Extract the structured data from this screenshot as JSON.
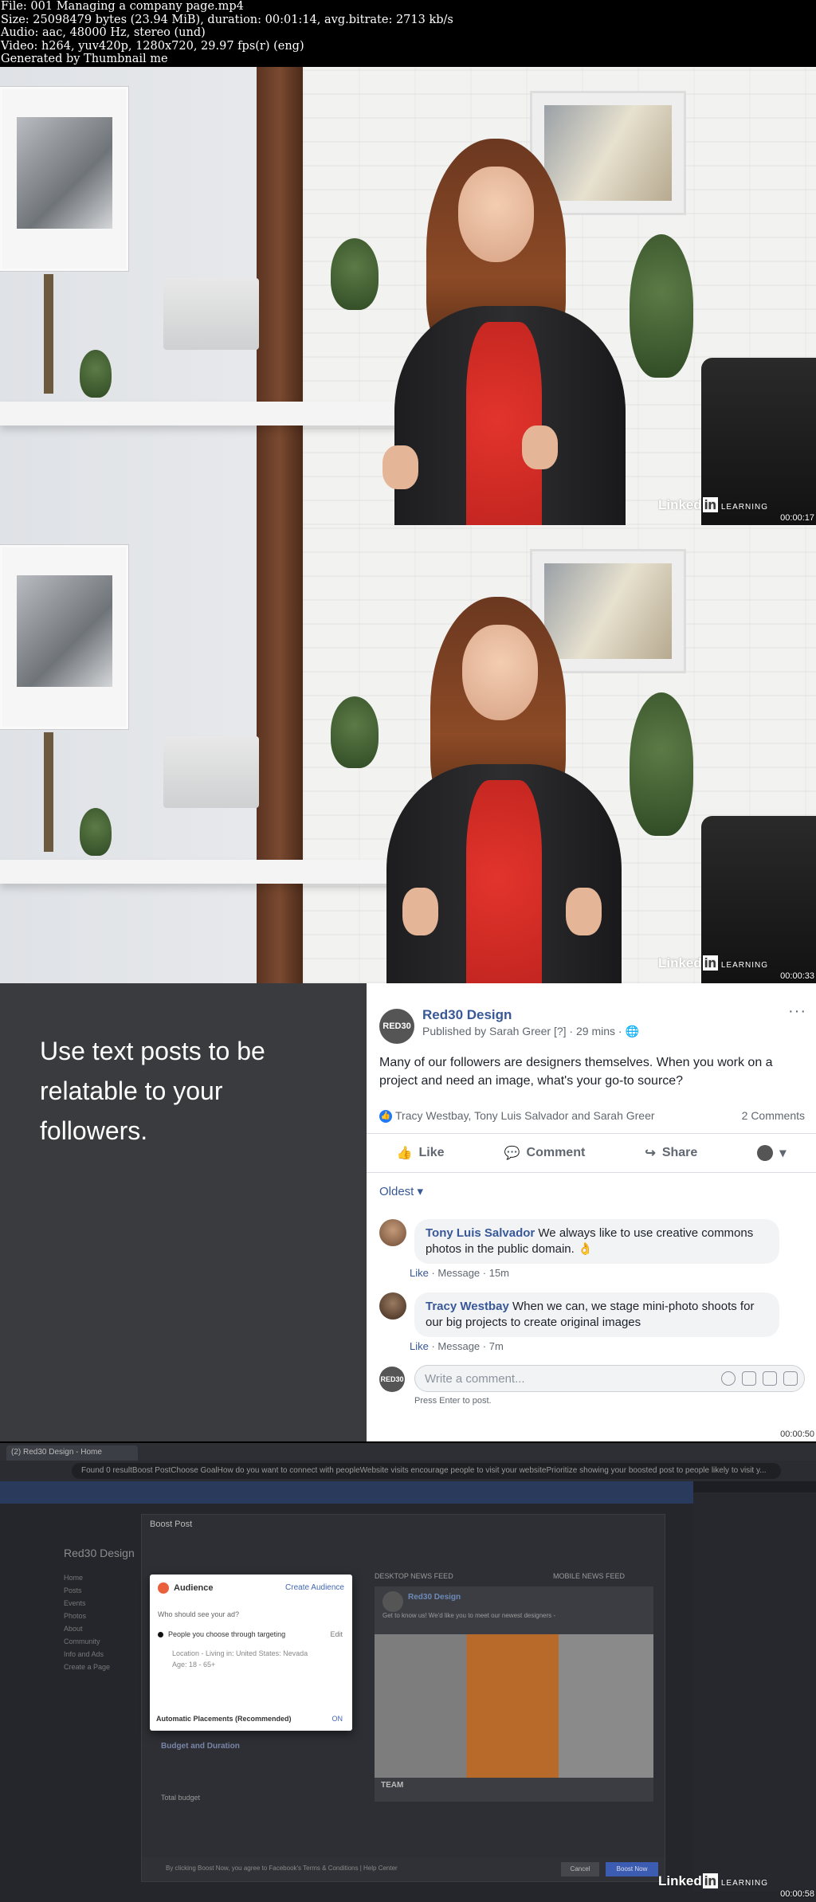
{
  "header": {
    "lines": [
      "File: 001 Managing a company page.mp4",
      "Size: 25098479 bytes (23.94 MiB), duration: 00:01:14, avg.bitrate: 2713 kb/s",
      "Audio: aac, 48000 Hz, stereo (und)",
      "Video: h264, yuv420p, 1280x720, 29.97 fps(r) (eng)",
      "Generated by Thumbnail me"
    ]
  },
  "frames": {
    "f1": {
      "watermark": "Linked",
      "watermark_in": "in",
      "watermark_sub": "LEARNING",
      "timestamp": "00:00:17"
    },
    "f2": {
      "watermark": "Linked",
      "watermark_in": "in",
      "watermark_sub": "LEARNING",
      "timestamp": "00:00:33"
    },
    "f3": {
      "timestamp": "00:00:50"
    },
    "f4": {
      "watermark": "Linked",
      "watermark_in": "in",
      "watermark_sub": "LEARNING",
      "timestamp": "00:00:58"
    }
  },
  "slide": {
    "caption": "Use text posts to be relatable to your followers."
  },
  "post": {
    "avatar": "RED30",
    "page_name": "Red30 Design",
    "meta": "Published by Sarah Greer [?] · 29 mins · ",
    "more": "···",
    "text": "Many of our followers are designers themselves. When you work on a project and need an image, what's your go-to source?",
    "reactions": "Tracy Westbay, Tony Luis Salvador and Sarah Greer",
    "comment_count": "2 Comments",
    "actions": {
      "like": "Like",
      "comment": "Comment",
      "share": "Share"
    },
    "sort": "Oldest ▾",
    "comments": [
      {
        "author": "Tony Luis Salvador",
        "text": " We always like to use creative commons photos in the public domain. 👌",
        "like": "Like",
        "message": " · Message · ",
        "time": "15m"
      },
      {
        "author": "Tracy Westbay",
        "text": " When we can, we stage mini-photo shoots for our big projects to create original images",
        "like": "Like",
        "message": " · Message · ",
        "time": "7m"
      }
    ],
    "write_placeholder": "Write a comment...",
    "hint": "Press Enter to post."
  },
  "boost": {
    "tab_label": "(2) Red30 Design - Home",
    "url": "Found 0 resultBoost PostChoose GoalHow do you want to connect with peopleWebsite visits encourage people to visit your websitePrioritize showing your boosted post to people likely to visit y...",
    "modal_title": "Boost Post",
    "popover": {
      "title": "Audience",
      "create_link": "Create Audience",
      "question": "Who should see your ad?",
      "option": "People you choose through targeting",
      "edit": "Edit",
      "location": "Location - Living in: United States: Nevada",
      "age": "Age: 18 - 65+",
      "placements": "Automatic Placements (Recommended)",
      "toggle": "ON"
    },
    "preview_tabs": {
      "desktop": "DESKTOP NEWS FEED",
      "mobile": "MOBILE NEWS FEED"
    },
    "preview": {
      "page_name": "Red30 Design",
      "text": "Get to know us! We'd like you to meet our newest designers -",
      "team": "TEAM"
    },
    "sidebar": {
      "name": "Red30 Design",
      "items": [
        "Home",
        "Posts",
        "Events",
        "Photos",
        "About",
        "Community",
        "Info and Ads",
        "Create a Page"
      ]
    },
    "sections": {
      "budget": "Budget and Duration",
      "total_budget": "Total budget"
    },
    "footer": {
      "terms": "By clicking Boost Now, you agree to Facebook's Terms & Conditions | Help Center",
      "cancel": "Cancel",
      "boost": "Boost Now"
    }
  }
}
